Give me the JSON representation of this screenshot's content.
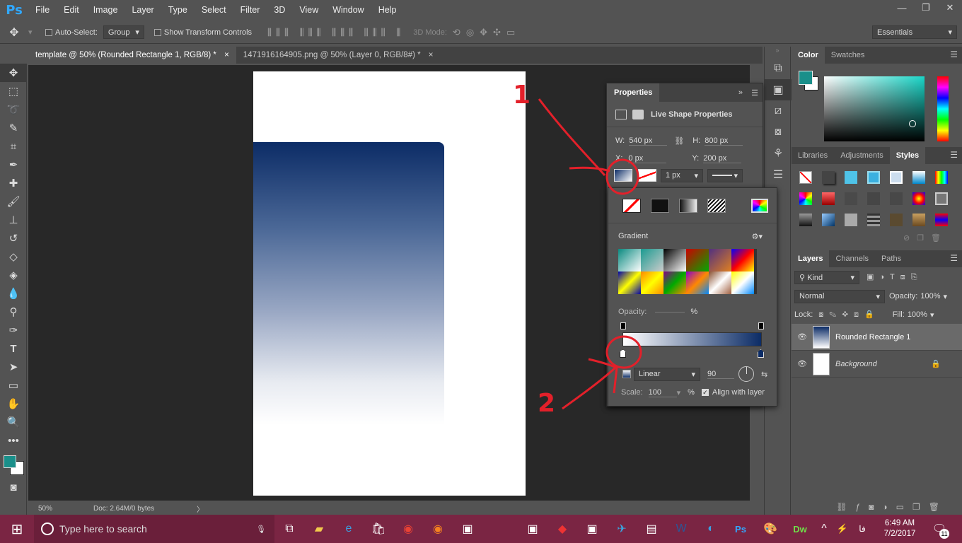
{
  "app": {
    "logo": "Ps",
    "menus": [
      "File",
      "Edit",
      "Image",
      "Layer",
      "Type",
      "Select",
      "Filter",
      "3D",
      "View",
      "Window",
      "Help"
    ],
    "win_controls": [
      "—",
      "❐",
      "✕"
    ]
  },
  "options": {
    "auto_select_label": "Auto-Select:",
    "auto_select_value": "Group",
    "show_transform": "Show Transform Controls",
    "mode_3d": "3D Mode:",
    "workspace": "Essentials"
  },
  "tabs": [
    {
      "label": "template @ 50% (Rounded Rectangle 1, RGB/8) *",
      "close": "×"
    },
    {
      "label": "1471916164905.png @ 50% (Layer 0, RGB/8#) *",
      "close": "×"
    }
  ],
  "status": {
    "zoom": "50%",
    "doc": "Doc: 2.64M/0 bytes",
    "arrow": "〉"
  },
  "properties": {
    "title": "Properties",
    "subtitle": "Live Shape Properties",
    "w_label": "W:",
    "w_value": "540 px",
    "h_label": "H:",
    "h_value": "800 px",
    "x_label": "X:",
    "x_value": "0 px",
    "y_label": "Y:",
    "y_value": "200 px",
    "stroke_width": "1 px"
  },
  "gradient": {
    "title": "Gradient",
    "opacity_label": "Opacity:",
    "opacity_unit": "%",
    "style": "Linear",
    "angle": "90",
    "scale_label": "Scale:",
    "scale_value": "100",
    "scale_unit": "%",
    "align_label": "Align with layer"
  },
  "color_panel": {
    "tabs": [
      "Color",
      "Swatches"
    ],
    "fg": "#1a8f8a",
    "bg": "#ffffff"
  },
  "styles_panel": {
    "tabs": [
      "Libraries",
      "Adjustments",
      "Styles"
    ]
  },
  "layers_panel": {
    "tabs": [
      "Layers",
      "Channels",
      "Paths"
    ],
    "filter": "Kind",
    "blend": "Normal",
    "opacity_label": "Opacity:",
    "opacity_value": "100%",
    "lock_label": "Lock:",
    "fill_label": "Fill:",
    "fill_value": "100%",
    "layers": [
      {
        "name": "Rounded Rectangle 1"
      },
      {
        "name": "Background"
      }
    ]
  },
  "taskbar": {
    "search_placeholder": "Type here to search",
    "time": "6:49 AM",
    "date": "7/2/2017",
    "lang": "فا",
    "notif": "11"
  },
  "annotations": {
    "one": "1",
    "two": "2"
  },
  "colors": {
    "annotation_red": "#e3202a",
    "accent_blue": "#31a8ff"
  }
}
